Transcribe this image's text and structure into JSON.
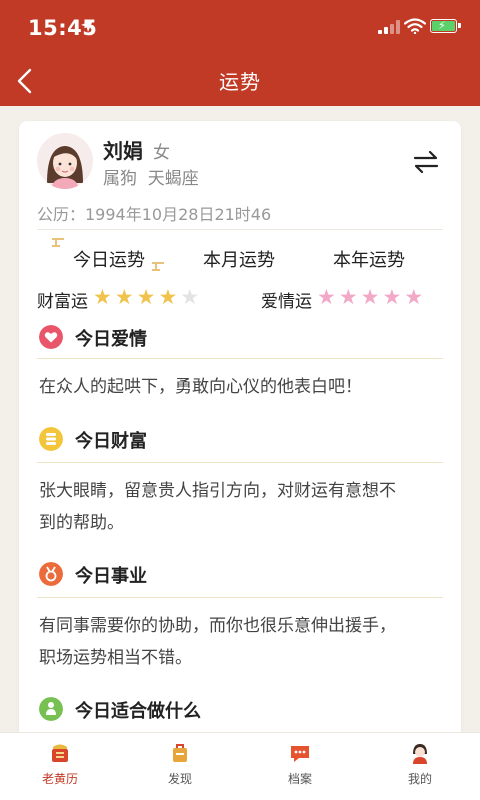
{
  "status": {
    "time": "15:45"
  },
  "nav": {
    "title": "运势"
  },
  "profile": {
    "name": "刘娟",
    "gender": "女",
    "meta": "属狗  天蝎座",
    "birth": "公历：1994年10月28日21时46"
  },
  "tabs": [
    {
      "label": "今日运势",
      "active": true
    },
    {
      "label": "本月运势",
      "active": false
    },
    {
      "label": "本年运势",
      "active": false
    }
  ],
  "ratings": {
    "wealth": {
      "label": "财富运",
      "value": 4,
      "max": 5,
      "color": "#f0c44c",
      "empty_color": "#e3e3e3"
    },
    "love": {
      "label": "爱情运",
      "value": 5,
      "max": 5,
      "color": "#f2a9c8"
    }
  },
  "sections": [
    {
      "icon": "heart-icon",
      "color": "#e9566a",
      "title": "今日爱情",
      "text": [
        "在众人的起哄下，勇敢向心仪的他表白吧！"
      ]
    },
    {
      "icon": "coins-icon",
      "color": "#f3c53a",
      "title": "今日财富",
      "text": [
        "张大眼睛，留意贵人指引方向，对财运有意想不",
        "到的帮助。"
      ]
    },
    {
      "icon": "medal-icon",
      "color": "#ec6b3a",
      "title": "今日事业",
      "text": [
        "有同事需要你的协助，而你也很乐意伸出援手，",
        "职场运势相当不错。"
      ]
    },
    {
      "icon": "person-icon",
      "color": "#77c153",
      "title": "今日适合做什么",
      "text": []
    }
  ],
  "tabbar": [
    {
      "label": "老黄历",
      "icon": "almanac-icon",
      "active": true
    },
    {
      "label": "发现",
      "icon": "discover-icon",
      "active": false
    },
    {
      "label": "档案",
      "icon": "archive-icon",
      "active": false
    },
    {
      "label": "我的",
      "icon": "profile-icon",
      "active": false
    }
  ],
  "colors": {
    "header": "#c13a25",
    "accent": "#c13a25"
  }
}
